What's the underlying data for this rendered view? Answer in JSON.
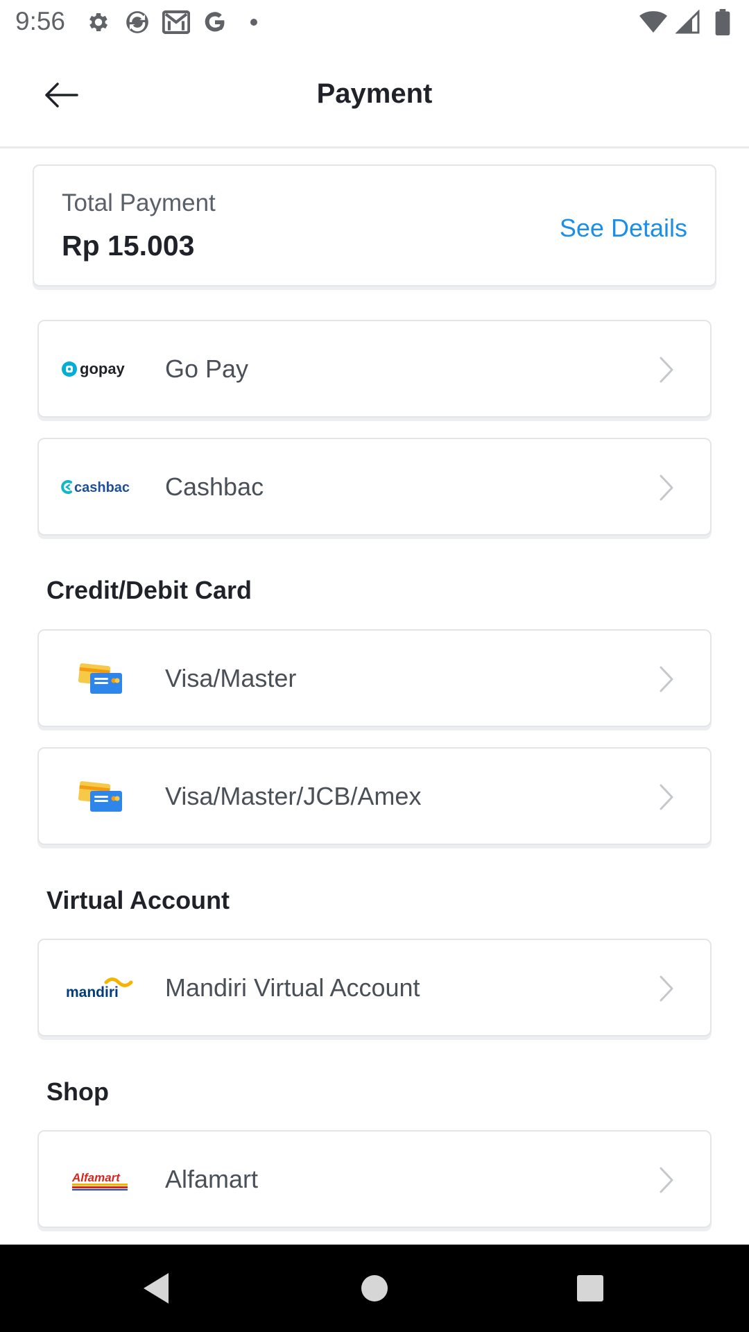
{
  "status_bar": {
    "time": "9:56",
    "left_icons": [
      "gear-icon",
      "sync-icon",
      "gmail-icon",
      "google-icon",
      "dot-icon"
    ],
    "right_icons": [
      "wifi-icon",
      "signal-icon",
      "battery-icon"
    ]
  },
  "header": {
    "title": "Payment",
    "back_icon": "arrow-left-icon"
  },
  "total": {
    "label": "Total Payment",
    "amount": "Rp 15.003",
    "details_link": "See Details",
    "link_color": "#1a8ee8"
  },
  "wallets": [
    {
      "label": "Go Pay",
      "logo_text": "gopay",
      "logo": "gopay-logo"
    },
    {
      "label": "Cashbac",
      "logo_text": "cashbac",
      "logo": "cashbac-logo"
    }
  ],
  "sections": {
    "cards": {
      "title": "Credit/Debit Card",
      "items": [
        {
          "label": "Visa/Master",
          "logo": "credit-card-icon"
        },
        {
          "label": "Visa/Master/JCB/Amex",
          "logo": "credit-card-icon"
        }
      ]
    },
    "virtual_account": {
      "title": "Virtual Account",
      "items": [
        {
          "label": "Mandiri Virtual Account",
          "logo_text": "mandiri",
          "logo": "mandiri-logo"
        }
      ]
    },
    "shop": {
      "title": "Shop",
      "items": [
        {
          "label": "Alfamart",
          "logo_text": "Alfamart",
          "logo": "alfamart-logo"
        }
      ]
    }
  },
  "nav_bar": {
    "buttons": [
      "back-triangle-icon",
      "home-circle-icon",
      "recents-square-icon"
    ]
  }
}
